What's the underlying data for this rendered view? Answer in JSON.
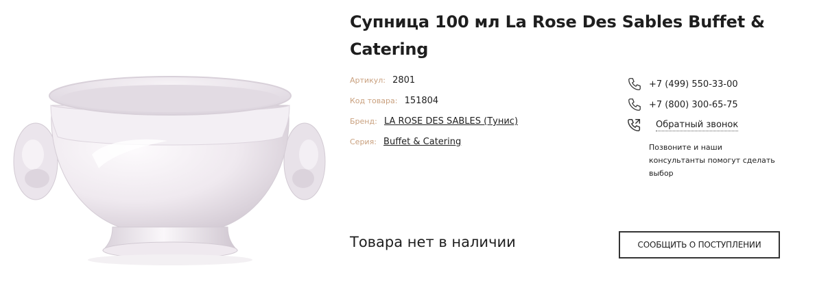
{
  "product": {
    "title": "Супница 100 мл La Rose Des Sables Buffet & Catering",
    "image_alt": "soup-bowl-icon"
  },
  "specs": {
    "article_label": "Артикул:",
    "article_value": "2801",
    "code_label": "Код товара:",
    "code_value": "151804",
    "brand_label": "Бренд:",
    "brand_value": "LA ROSE DES SABLES (Тунис)",
    "series_label": "Серия:",
    "series_value": "Buffet & Catering"
  },
  "contacts": {
    "phone_1": "+7 (499) 550-33-00",
    "phone_2": "+7 (800) 300-65-75",
    "callback_label": "Обратный звонок",
    "note": "Позвоните и наши консультанты помогут сделать выбор",
    "icons": [
      "phone-icon",
      "phone-icon",
      "callback-icon"
    ]
  },
  "availability": {
    "status": "Товара нет в наличии",
    "notify_button": "СООБЩИТЬ О ПОСТУПЛЕНИИ"
  },
  "colors": {
    "label": "#c9a07e",
    "text": "#1e1e1e",
    "button_border": "#333333"
  }
}
